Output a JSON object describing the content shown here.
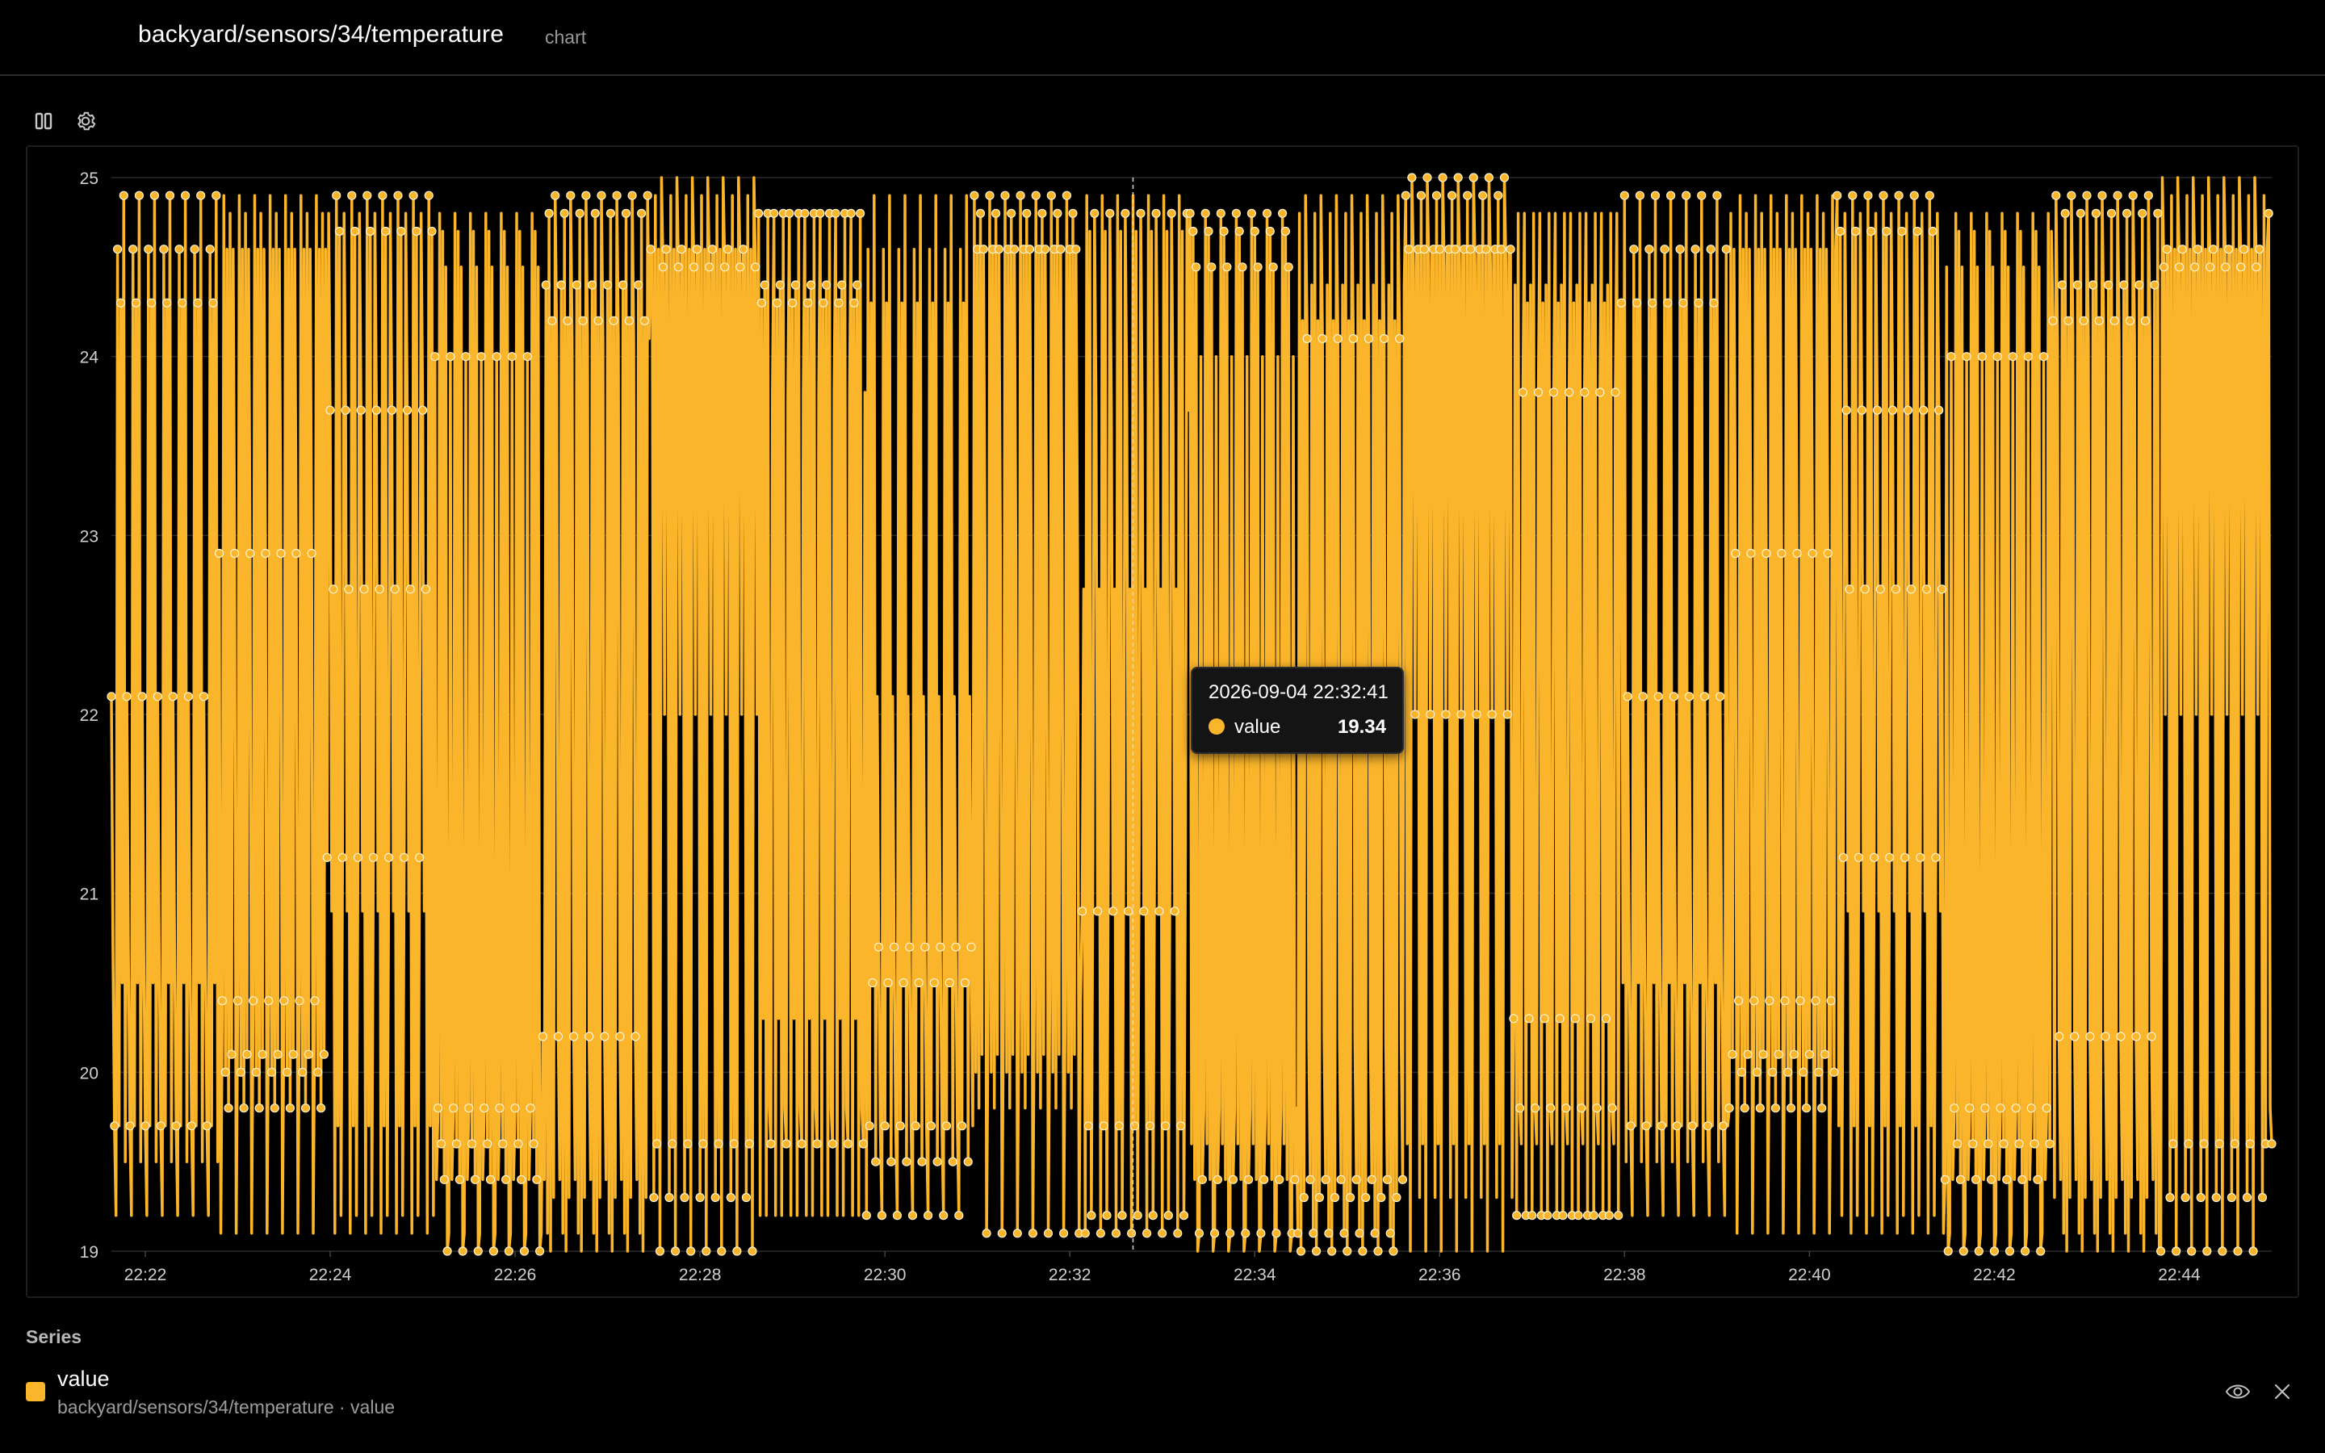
{
  "header": {
    "title": "backyard/sensors/34/temperature",
    "subtitle": "chart"
  },
  "toolbar": {
    "pause_icon": "pause-icon",
    "settings_icon": "gear-icon"
  },
  "colors": {
    "series": "#fbb52a",
    "background": "#000000",
    "grid": "#2a2a2a",
    "axis_text": "#cfcfcf"
  },
  "tooltip": {
    "time": "2026-09-04 22:32:41",
    "series_name": "value",
    "value": "19.34"
  },
  "legend": {
    "heading": "Series",
    "items": [
      {
        "name": "value",
        "path": "backyard/sensors/34/temperature · value",
        "visibility_icon": "eye-icon",
        "remove_icon": "close-icon"
      }
    ]
  },
  "chart_data": {
    "type": "line",
    "title": "",
    "xlabel": "",
    "ylabel": "",
    "ylim": [
      19,
      25
    ],
    "yticks": [
      19,
      20,
      21,
      22,
      23,
      24,
      25
    ],
    "xlim": [
      "22:21:38",
      "22:45:00"
    ],
    "xticks": [
      "22:22",
      "22:24",
      "22:26",
      "22:28",
      "22:30",
      "22:32",
      "22:34",
      "22:36",
      "22:38",
      "22:40",
      "22:42",
      "22:44"
    ],
    "grid": "horizontal",
    "markers": true,
    "cursor_x": "22:32:41",
    "series": [
      {
        "name": "value",
        "x_interval_seconds": 1,
        "x_start": "22:21:38",
        "values": [
          22.1,
          24.5,
          19.1,
          22.9,
          19.6,
          24.1,
          21.2,
          20.7,
          22.0,
          24.0,
          19.1,
          23.8,
          20.2,
          24.8,
          19.7,
          24.6,
          19.4,
          20.4,
          24.8,
          19.4,
          23.7,
          19.2,
          24.6,
          19.8,
          24.9,
          19.2,
          24.4,
          20.9,
          24.6,
          19.3,
          24.8,
          20.0,
          24.3,
          19.1,
          22.7,
          19.7,
          24.9,
          19.6,
          24.6,
          20.3,
          24.8,
          19.1,
          24.3,
          19.6,
          24.7,
          19.8,
          24.4,
          19.0,
          24.9,
          20.5,
          24.6,
          19.4,
          24.8,
          19.2,
          24.2,
          19.7,
          24.9,
          19.0,
          24.5,
          20.1,
          24.8,
          19.3,
          24.7,
          19.5,
          25.0,
          19.0,
          24.6,
          19.8,
          24.9,
          19.2
        ]
      }
    ]
  }
}
